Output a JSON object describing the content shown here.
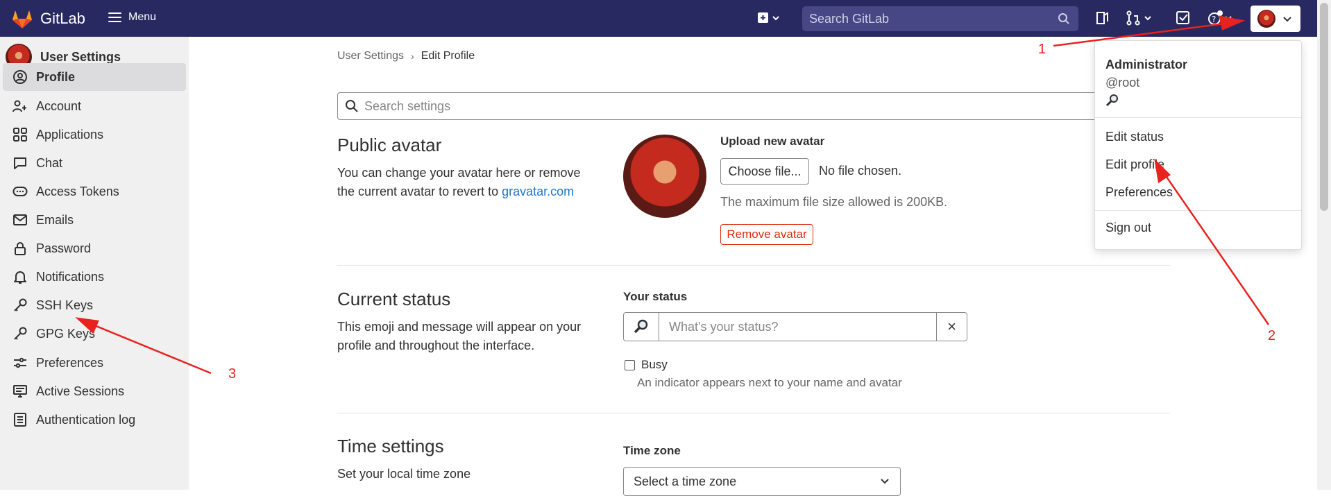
{
  "topbar": {
    "brand": "GitLab",
    "menu_label": "Menu",
    "search_placeholder": "Search GitLab"
  },
  "sidebar": {
    "title": "User Settings",
    "items": [
      {
        "label": "Profile",
        "icon": "profile-icon",
        "active": true
      },
      {
        "label": "Account",
        "icon": "account-icon"
      },
      {
        "label": "Applications",
        "icon": "applications-icon"
      },
      {
        "label": "Chat",
        "icon": "chat-icon"
      },
      {
        "label": "Access Tokens",
        "icon": "token-icon"
      },
      {
        "label": "Emails",
        "icon": "mail-icon"
      },
      {
        "label": "Password",
        "icon": "lock-icon"
      },
      {
        "label": "Notifications",
        "icon": "bell-icon"
      },
      {
        "label": "SSH Keys",
        "icon": "key-icon"
      },
      {
        "label": "GPG Keys",
        "icon": "key-icon"
      },
      {
        "label": "Preferences",
        "icon": "preferences-icon"
      },
      {
        "label": "Active Sessions",
        "icon": "monitor-icon"
      },
      {
        "label": "Authentication log",
        "icon": "log-icon"
      }
    ]
  },
  "breadcrumb": {
    "parent": "User Settings",
    "current": "Edit Profile"
  },
  "settings_search_placeholder": "Search settings",
  "avatar_section": {
    "title": "Public avatar",
    "desc_prefix": "You can change your avatar here or remove the current avatar to revert to ",
    "desc_link": "gravatar.com",
    "upload_label": "Upload new avatar",
    "choose_file": "Choose file...",
    "no_file": "No file chosen.",
    "max_size": "The maximum file size allowed is 200KB.",
    "remove": "Remove avatar"
  },
  "status_section": {
    "title": "Current status",
    "desc": "This emoji and message will appear on your profile and throughout the interface.",
    "your_status": "Your status",
    "placeholder": "What's your status?",
    "clear": "×",
    "busy": "Busy",
    "busy_help": "An indicator appears next to your name and avatar"
  },
  "time_section": {
    "title": "Time settings",
    "desc": "Set your local time zone",
    "tz_label": "Time zone",
    "tz_value": "Select a time zone"
  },
  "user_dropdown": {
    "name": "Administrator",
    "username": "@root",
    "items": [
      "Edit status",
      "Edit profile",
      "Preferences"
    ],
    "sign_out": "Sign out"
  },
  "annotations": [
    "1",
    "2",
    "3"
  ],
  "colors": {
    "navbar": "#292961",
    "link": "#1f75cb",
    "danger": "#dd2b0e",
    "annotation": "#e8221f"
  }
}
